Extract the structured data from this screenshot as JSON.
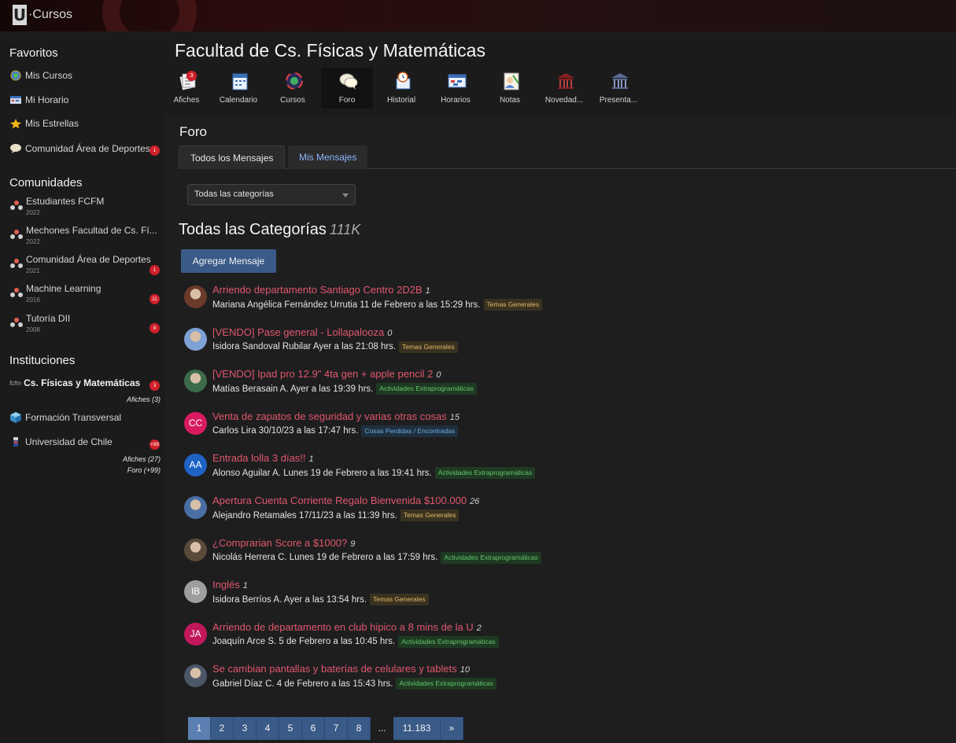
{
  "app": {
    "logo_letter": "U",
    "logo_text": "·Cursos"
  },
  "sidebar": {
    "favoritos_title": "Favoritos",
    "favoritos": [
      {
        "label": "Mis Cursos",
        "icon": "courses-globe-icon"
      },
      {
        "label": "Mi Horario",
        "icon": "schedule-icon"
      },
      {
        "label": "Mis Estrellas",
        "icon": "stars-icon"
      },
      {
        "label": "Comunidad Área de Deportes",
        "icon": "chat-bubble-icon",
        "badge": "1"
      }
    ],
    "comunidades_title": "Comunidades",
    "comunidades": [
      {
        "name": "Estudiantes FCFM",
        "year": "2022"
      },
      {
        "name": "Mechones Facultad de Cs. Fí...",
        "year": "2022"
      },
      {
        "name": "Comunidad Área de Deportes",
        "year": "2021",
        "badge": "1"
      },
      {
        "name": "Machine Learning",
        "year": "2016",
        "badge": "11"
      },
      {
        "name": "Tutoría DII",
        "year": "2008",
        "badge": "8"
      }
    ],
    "instituciones_title": "Instituciones",
    "instituciones": [
      {
        "name": "Cs. Físicas y Matemáticas",
        "prefix": "fcfm",
        "badge": "3",
        "links": [
          "Afiches (3)"
        ]
      },
      {
        "name": "Formación Transversal",
        "prefix": ""
      },
      {
        "name": "Universidad de Chile",
        "prefix": "",
        "badge": "+99",
        "links": [
          "Afiches (27)",
          "Foro (+99)"
        ]
      }
    ]
  },
  "header": {
    "title": "Facultad de Cs. Físicas y Matemáticas",
    "tools": [
      {
        "label": "Afiches",
        "icon": "posters-icon",
        "badge": "3"
      },
      {
        "label": "Calendario",
        "icon": "calendar-icon"
      },
      {
        "label": "Cursos",
        "icon": "courses-icon"
      },
      {
        "label": "Foro",
        "icon": "forum-icon"
      },
      {
        "label": "Historial",
        "icon": "history-icon"
      },
      {
        "label": "Horarios",
        "icon": "schedules-icon"
      },
      {
        "label": "Notas",
        "icon": "grades-icon"
      },
      {
        "label": "Novedad...",
        "icon": "news-icon"
      },
      {
        "label": "Presenta...",
        "icon": "presentation-icon"
      }
    ]
  },
  "forum": {
    "heading": "Foro",
    "tab_all": "Todos los Mensajes",
    "tab_mine": "Mis Mensajes",
    "category_select": "Todas las categorías",
    "category_title": "Todas las Categorías",
    "category_count": "111K",
    "add_button": "Agregar Mensaje",
    "posts": [
      {
        "title": "Arriendo departamento Santiago Centro 2D2B",
        "replies": "1",
        "meta": "Mariana Angélica Fernández Urrutia 11 de Febrero a las 15:29 hrs.",
        "tag": "Temas Generales",
        "tag_class": "tg",
        "avatar": "",
        "avatar_color": "#6b3a2a"
      },
      {
        "title": "[VENDO] Pase general - Lollapalooza",
        "replies": "0",
        "meta": "Isidora Sandoval Rubilar Ayer a las 21:08 hrs.",
        "tag": "Temas Generales",
        "tag_class": "tg",
        "avatar": "",
        "avatar_color": "#7fa2d6"
      },
      {
        "title": "[VENDO] Ipad pro 12.9\" 4ta gen + apple pencil 2",
        "replies": "0",
        "meta": "Matías Berasain A. Ayer a las 19:39 hrs.",
        "tag": "Actividades Extraprogramáticas",
        "tag_class": "ae",
        "avatar": "",
        "avatar_color": "#3c6b4a"
      },
      {
        "title": "Venta de zapatos de seguridad y varias otras cosas",
        "replies": "15",
        "meta": "Carlos Lira 30/10/23 a las 17:47 hrs.",
        "tag": "Cosas Perdidas / Encontradas",
        "tag_class": "cp",
        "avatar": "CC",
        "avatar_color": "#d81b60"
      },
      {
        "title": "Entrada lolla 3 días!!",
        "replies": "1",
        "meta": "Alonso Aguilar A. Lunes 19 de Febrero a las 19:41 hrs.",
        "tag": "Actividades Extraprogramáticas",
        "tag_class": "ae",
        "avatar": "AA",
        "avatar_color": "#1e63c4"
      },
      {
        "title": "Apertura Cuenta Corriente Regalo Bienvenida $100.000",
        "replies": "26",
        "meta": "Alejandro Retamales 17/11/23 a las 11:39 hrs.",
        "tag": "Temas Generales",
        "tag_class": "tg",
        "avatar": "",
        "avatar_color": "#4a6fa5"
      },
      {
        "title": "¿Comprarian Score a $1000?",
        "replies": "9",
        "meta": "Nicolás Herrera C. Lunes 19 de Febrero a las 17:59 hrs.",
        "tag": "Actividades Extraprogramáticas",
        "tag_class": "ae",
        "avatar": "",
        "avatar_color": "#5a4a3a"
      },
      {
        "title": "Inglés",
        "replies": "1",
        "meta": "Isidora Berríos A. Ayer a las 13:54 hrs.",
        "tag": "Temas Generales",
        "tag_class": "tg",
        "avatar": "IB",
        "avatar_color": "#9e9e9e"
      },
      {
        "title": "Arriendo de departamento en club hipico a 8 mins de la U",
        "replies": "2",
        "meta": "Joaquín Arce S. 5 de Febrero a las 10:45 hrs.",
        "tag": "Actividades Extraprogramáticas",
        "tag_class": "ae",
        "avatar": "JA",
        "avatar_color": "#c2185b"
      },
      {
        "title": "Se cambian pantallas y baterías de celulares y tablets",
        "replies": "10",
        "meta": "Gabriel Díaz C. 4 de Febrero a las 15:43 hrs.",
        "tag": "Actividades Extraprogramáticas",
        "tag_class": "ae",
        "avatar": "",
        "avatar_color": "#4c5868"
      }
    ],
    "pagination": [
      "1",
      "2",
      "3",
      "4",
      "5",
      "6",
      "7",
      "8",
      "...",
      "11.183",
      "»"
    ]
  }
}
